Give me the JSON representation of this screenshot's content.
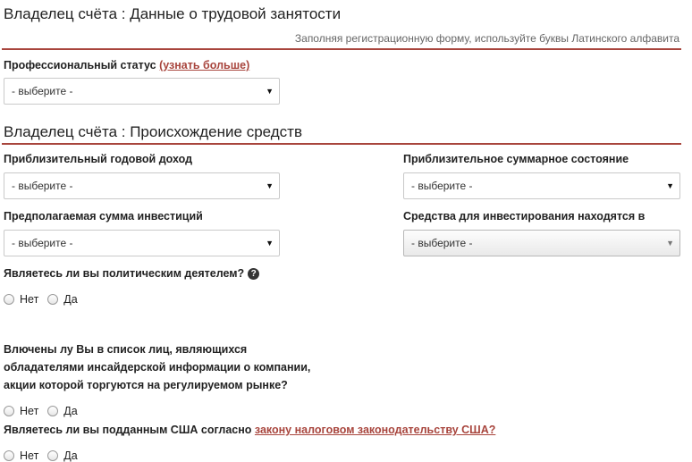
{
  "section1": {
    "title": "Владелец счёта : Данные о трудовой занятости",
    "hint": "Заполняя регистрационную форму, используйте буквы Латинского алфавита",
    "prof_status": {
      "label": "Профессиональный статус",
      "link": "(узнать больше)",
      "select_value": "- выберите -"
    }
  },
  "section2": {
    "title": "Владелец счёта : Происхождение средств",
    "annual_income": {
      "label": "Приблизительный годовой доход",
      "select_value": "- выберите -"
    },
    "total_wealth": {
      "label": "Приблизительное суммарное состояние",
      "select_value": "- выберите -"
    },
    "investment_amount": {
      "label": "Предполагаемая сумма инвестиций",
      "select_value": "- выберите -"
    },
    "funds_location": {
      "label": "Средства для инвестирования находятся в",
      "select_value": "- выберите -"
    },
    "pep_question": {
      "label": "Являетесь ли вы политическим деятелем?",
      "help": "?",
      "options": [
        "Нет",
        "Да"
      ]
    },
    "insider_question": {
      "label": "Влючены лу Вы в список лиц, являющихся обладателями инсайдерской информации о компании, акции которой торгуются на регулируемом рынке?",
      "options": [
        "Нет",
        "Да"
      ]
    },
    "us_question": {
      "label": "Являетесь ли вы подданным США согласно",
      "link": "закону налоговом законодательству США?",
      "options": [
        "Нет",
        "Да"
      ]
    }
  },
  "icons": {
    "dropdown": "▼",
    "help": "question-circle"
  },
  "colors": {
    "accent": "#a8453d"
  }
}
